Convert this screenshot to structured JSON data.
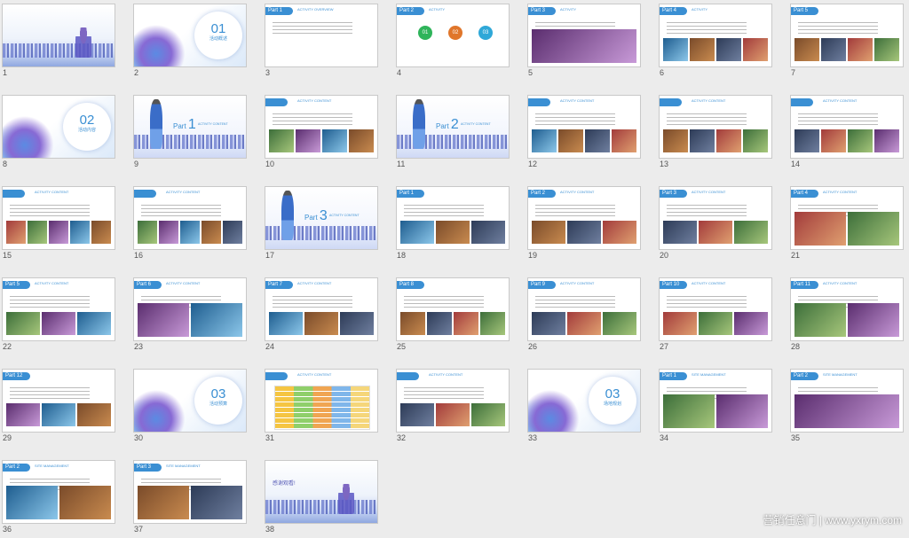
{
  "colors": {
    "accent": "#3a8fd3",
    "background": "#ececec"
  },
  "watermark": "营销任意门 | www.yxrym.com",
  "slides": [
    {
      "n": "1",
      "kind": "cover",
      "title": "",
      "subtitle": ""
    },
    {
      "n": "2",
      "kind": "section",
      "big": "01",
      "small": "活动概述"
    },
    {
      "n": "3",
      "kind": "content",
      "tag": "Part 1",
      "sub": "ACTIVITY OVERVIEW",
      "photos": 0
    },
    {
      "n": "4",
      "kind": "three",
      "tag": "Part 2",
      "sub": "ACTIVITY",
      "items": [
        "01",
        "02",
        "03"
      ],
      "labels": [
        "",
        "",
        ""
      ]
    },
    {
      "n": "5",
      "kind": "content",
      "tag": "Part 3",
      "sub": "ACTIVITY",
      "photos": 1
    },
    {
      "n": "6",
      "kind": "content",
      "tag": "Part 4",
      "sub": "ACTIVITY",
      "photos": 4
    },
    {
      "n": "7",
      "kind": "content",
      "tag": "Part 5",
      "sub": "",
      "photos": 4
    },
    {
      "n": "8",
      "kind": "section",
      "big": "02",
      "small": "活动内容"
    },
    {
      "n": "9",
      "kind": "part",
      "label": "Part",
      "digit": "1",
      "sub": "ACTIVITY CONTENT"
    },
    {
      "n": "10",
      "kind": "content",
      "tag": "",
      "sub": "ACTIVITY CONTENT",
      "photos": 4
    },
    {
      "n": "11",
      "kind": "part",
      "label": "Part",
      "digit": "2",
      "sub": "ACTIVITY CONTENT"
    },
    {
      "n": "12",
      "kind": "content",
      "tag": "",
      "sub": "ACTIVITY CONTENT",
      "photos": 4
    },
    {
      "n": "13",
      "kind": "content",
      "tag": "",
      "sub": "ACTIVITY CONTENT",
      "photos": 4
    },
    {
      "n": "14",
      "kind": "content",
      "tag": "",
      "sub": "ACTIVITY CONTENT",
      "photos": 4
    },
    {
      "n": "15",
      "kind": "content",
      "tag": "",
      "sub": "ACTIVITY CONTENT",
      "photos": 5
    },
    {
      "n": "16",
      "kind": "content",
      "tag": "",
      "sub": "ACTIVITY CONTENT",
      "photos": 5
    },
    {
      "n": "17",
      "kind": "part",
      "label": "Part",
      "digit": "3",
      "sub": "ACTIVITY CONTENT"
    },
    {
      "n": "18",
      "kind": "content",
      "tag": "Part 1",
      "sub": "",
      "photos": 3
    },
    {
      "n": "19",
      "kind": "content",
      "tag": "Part 2",
      "sub": "ACTIVITY CONTENT",
      "photos": 3
    },
    {
      "n": "20",
      "kind": "content",
      "tag": "Part 3",
      "sub": "ACTIVITY CONTENT",
      "photos": 3
    },
    {
      "n": "21",
      "kind": "content",
      "tag": "Part 4",
      "sub": "ACTIVITY CONTENT",
      "photos": 2
    },
    {
      "n": "22",
      "kind": "content",
      "tag": "Part 5",
      "sub": "ACTIVITY CONTENT",
      "photos": 3
    },
    {
      "n": "23",
      "kind": "content",
      "tag": "Part 6",
      "sub": "ACTIVITY CONTENT",
      "photos": 2
    },
    {
      "n": "24",
      "kind": "content",
      "tag": "Part 7",
      "sub": "ACTIVITY CONTENT",
      "photos": 3
    },
    {
      "n": "25",
      "kind": "content",
      "tag": "Part 8",
      "sub": "",
      "photos": 4
    },
    {
      "n": "26",
      "kind": "content",
      "tag": "Part 9",
      "sub": "ACTIVITY CONTENT",
      "photos": 3
    },
    {
      "n": "27",
      "kind": "content",
      "tag": "Part 10",
      "sub": "ACTIVITY CONTENT",
      "photos": 3
    },
    {
      "n": "28",
      "kind": "content",
      "tag": "Part 11",
      "sub": "ACTIVITY CONTENT",
      "photos": 2
    },
    {
      "n": "29",
      "kind": "content",
      "tag": "Part 12",
      "sub": "",
      "photos": 3
    },
    {
      "n": "30",
      "kind": "section",
      "big": "03",
      "small": "活动预算"
    },
    {
      "n": "31",
      "kind": "table",
      "tag": "",
      "sub": "ACTIVITY CONTENT"
    },
    {
      "n": "32",
      "kind": "content",
      "tag": "",
      "sub": "ACTIVITY CONTENT",
      "photos": 3
    },
    {
      "n": "33",
      "kind": "section",
      "big": "03",
      "small": "场地规划"
    },
    {
      "n": "34",
      "kind": "content",
      "tag": "Part 1",
      "sub": "SITE MANAGEMENT",
      "photos": 2
    },
    {
      "n": "35",
      "kind": "content",
      "tag": "Part 2",
      "sub": "SITE MANAGEMENT",
      "photos": 1
    },
    {
      "n": "36",
      "kind": "content",
      "tag": "Part 2",
      "sub": "SITE MANAGEMENT",
      "photos": 2
    },
    {
      "n": "37",
      "kind": "content",
      "tag": "Part 3",
      "sub": "SITE MANAGEMENT",
      "photos": 2
    },
    {
      "n": "38",
      "kind": "cover",
      "title": "感谢观看!",
      "subtitle": ""
    }
  ]
}
